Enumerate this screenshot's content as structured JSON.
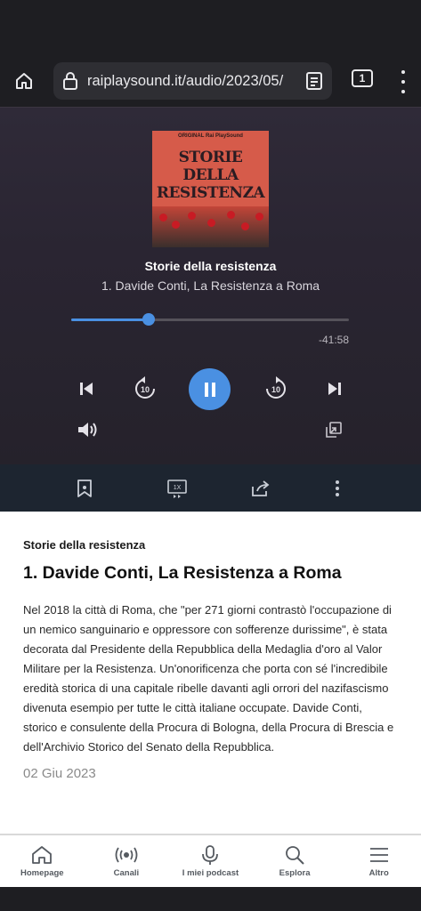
{
  "browser": {
    "url": "raiplaysound.it/audio/2023/05/",
    "tab_count": "1"
  },
  "cover": {
    "top_text": "ORIGINAL Rai PlaySound",
    "title_line1": "STORIE DELLA",
    "title_line2": "RESISTENZA"
  },
  "player": {
    "show_title": "Storie della resistenza",
    "episode_title": "1. Davide Conti, La Resistenza a Roma",
    "progress_fraction": 0.28,
    "remaining_time": "-41:58",
    "accent_color": "#4a90e2"
  },
  "actions": {
    "items": [
      "bookmark-icon",
      "speed-icon",
      "share-icon",
      "more-icon"
    ],
    "speed_label": "1X"
  },
  "content": {
    "show_name": "Storie della resistenza",
    "episode_title": "1. Davide Conti, La Resistenza a Roma",
    "description": "Nel 2018 la città di Roma, che \"per 271 giorni contrastò l'occupazione di un nemico sanguinario e oppressore con sofferenze durissime\", è stata decorata dal Presidente della Repubblica della Medaglia d'oro al Valor Militare per la Resistenza. Un'onorificenza che porta con sé l'incredibile eredità storica di una capitale ribelle davanti agli orrori del nazifascismo divenuta esempio per tutte le città italiane occupate. Davide Conti, storico e consulente della Procura di Bologna, della Procura di Brescia e dell'Archivio Storico del Senato della Repubblica.",
    "date": "02 Giu 2023"
  },
  "tabbar": {
    "tabs": [
      {
        "label": "Homepage",
        "icon": "home-icon"
      },
      {
        "label": "Canali",
        "icon": "broadcast-icon"
      },
      {
        "label": "I miei podcast",
        "icon": "microphone-icon"
      },
      {
        "label": "Esplora",
        "icon": "search-icon"
      },
      {
        "label": "Altro",
        "icon": "hamburger-icon"
      }
    ]
  }
}
